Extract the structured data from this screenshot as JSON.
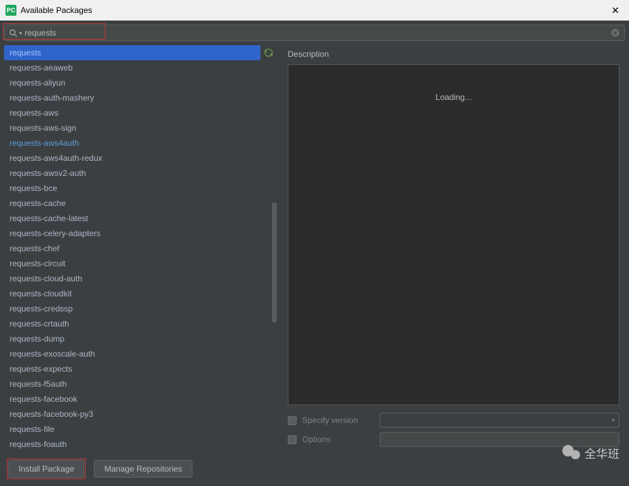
{
  "titlebar": {
    "icon_text": "PC",
    "title": "Available Packages"
  },
  "search": {
    "value": "requests"
  },
  "selected_package": "requests",
  "packages": [
    {
      "name": "requests-aeaweb",
      "highlighted": false
    },
    {
      "name": "requests-aliyun",
      "highlighted": false
    },
    {
      "name": "requests-auth-mashery",
      "highlighted": false
    },
    {
      "name": "requests-aws",
      "highlighted": false
    },
    {
      "name": "requests-aws-sign",
      "highlighted": false
    },
    {
      "name": "requests-aws4auth",
      "highlighted": true
    },
    {
      "name": "requests-aws4auth-redux",
      "highlighted": false
    },
    {
      "name": "requests-awsv2-auth",
      "highlighted": false
    },
    {
      "name": "requests-bce",
      "highlighted": false
    },
    {
      "name": "requests-cache",
      "highlighted": false
    },
    {
      "name": "requests-cache-latest",
      "highlighted": false
    },
    {
      "name": "requests-celery-adapters",
      "highlighted": false
    },
    {
      "name": "requests-chef",
      "highlighted": false
    },
    {
      "name": "requests-circuit",
      "highlighted": false
    },
    {
      "name": "requests-cloud-auth",
      "highlighted": false
    },
    {
      "name": "requests-cloudkit",
      "highlighted": false
    },
    {
      "name": "requests-credssp",
      "highlighted": false
    },
    {
      "name": "requests-crtauth",
      "highlighted": false
    },
    {
      "name": "requests-dump",
      "highlighted": false
    },
    {
      "name": "requests-exoscale-auth",
      "highlighted": false
    },
    {
      "name": "requests-expects",
      "highlighted": false
    },
    {
      "name": "requests-f5auth",
      "highlighted": false
    },
    {
      "name": "requests-facebook",
      "highlighted": false
    },
    {
      "name": "requests-facebook-py3",
      "highlighted": false
    },
    {
      "name": "requests-file",
      "highlighted": false
    },
    {
      "name": "requests-foauth",
      "highlighted": false
    }
  ],
  "right": {
    "description_label": "Description",
    "loading_text": "Loading...",
    "specify_version_label": "Specify version",
    "options_label": "Options"
  },
  "buttons": {
    "install": "Install Package",
    "manage": "Manage Repositories"
  },
  "watermark": {
    "text": "全华班"
  }
}
